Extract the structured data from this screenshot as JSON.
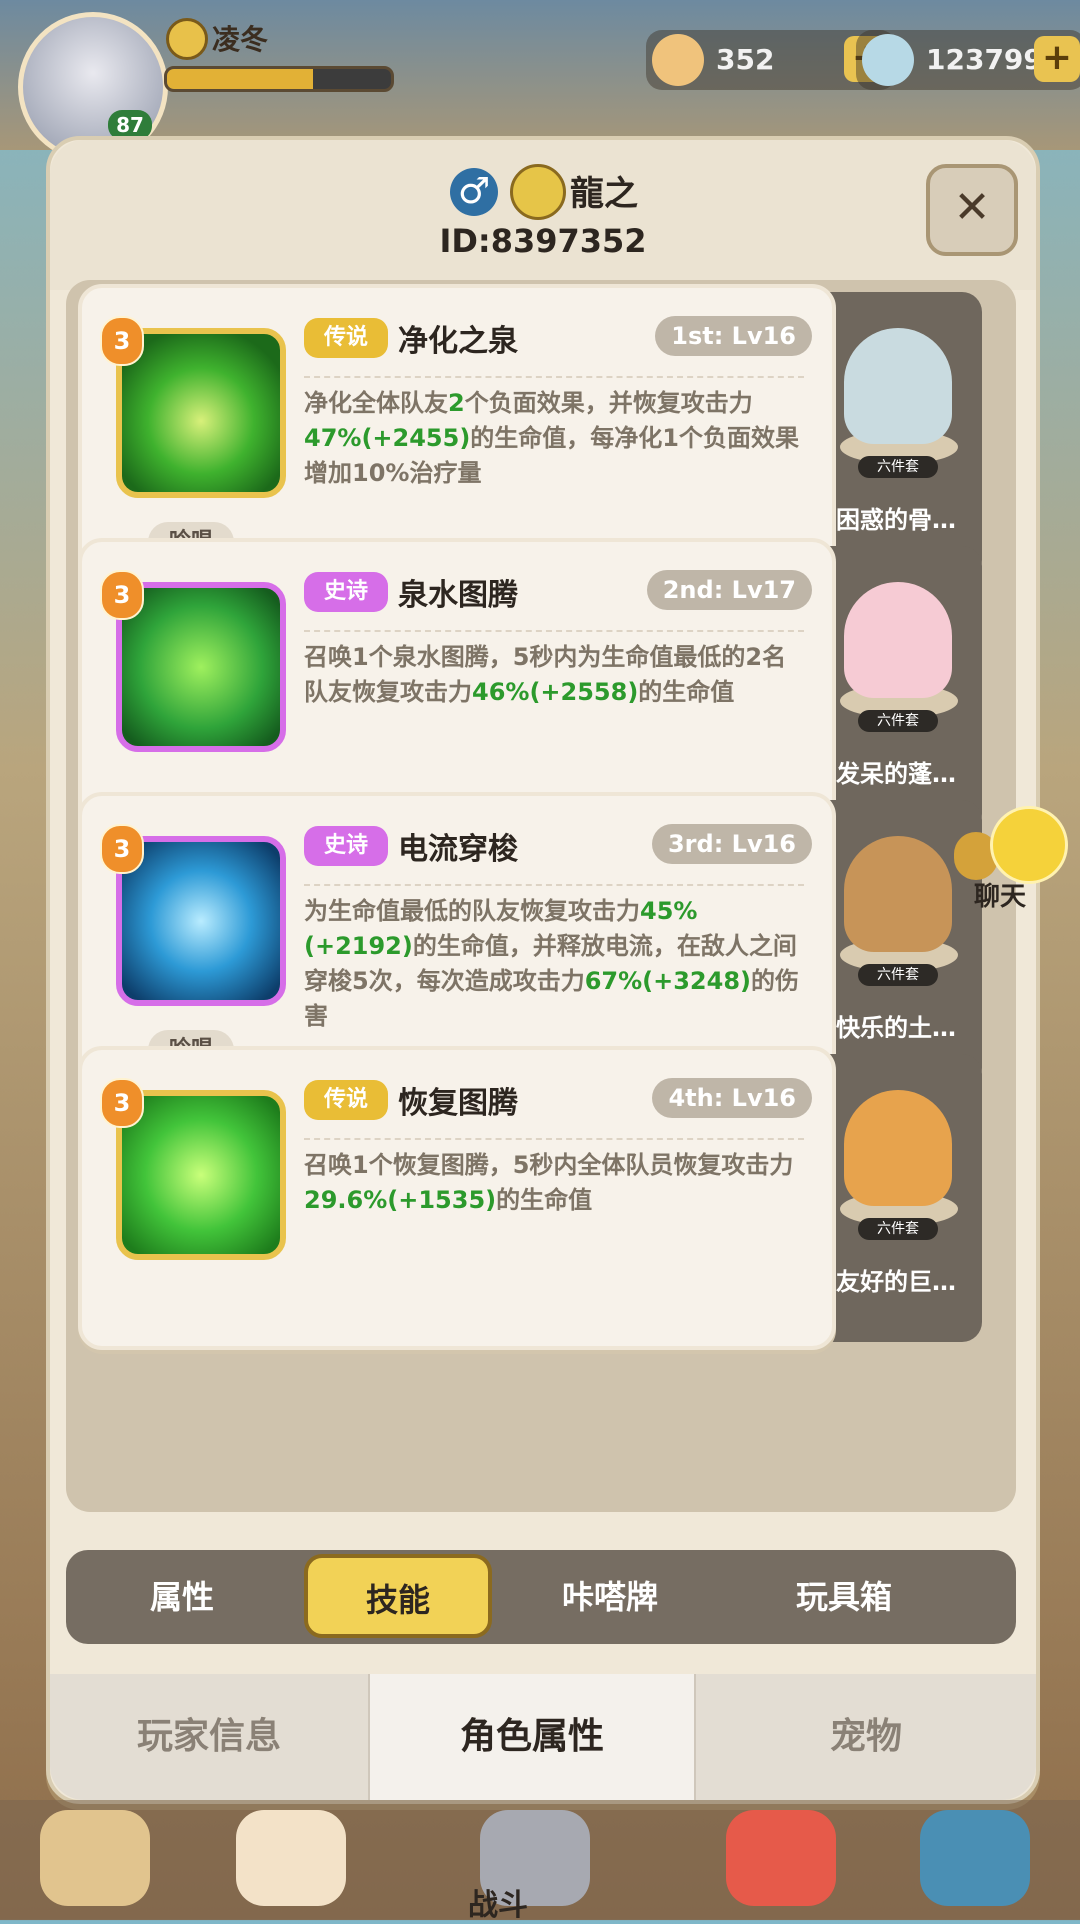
{
  "header": {
    "player_name": "凌冬",
    "avatar_level": "87",
    "xp_fraction": 0.65,
    "currency_1": "352",
    "currency_2": "123799"
  },
  "modal": {
    "title_name": "龍之",
    "id_text": "ID:8397352",
    "close_symbol": "✕"
  },
  "skills": [
    {
      "rarity": "传说",
      "name": "净化之泉",
      "rank": "1st: Lv16",
      "badge": "3",
      "chant": "吟唱",
      "desc_parts": [
        "净化全体队友",
        "2",
        "个负面效果，并恢复攻击力",
        "47%(+2455)",
        "的生命值，每净化1个负面效果增加10%治疗量"
      ],
      "rune_tag": "六件套",
      "rune_name": "困惑的骨…"
    },
    {
      "rarity": "史诗",
      "name": "泉水图腾",
      "rank": "2nd: Lv17",
      "badge": "3",
      "chant": "",
      "desc_parts": [
        "召唤1个泉水图腾，5秒内为生命值最低的2名队友恢复攻击力",
        "46%(+2558)",
        "的生命值"
      ],
      "rune_tag": "六件套",
      "rune_name": "发呆的蓬…"
    },
    {
      "rarity": "史诗",
      "name": "电流穿梭",
      "rank": "3rd: Lv16",
      "badge": "3",
      "chant": "吟唱",
      "desc_parts": [
        "为生命值最低的队友恢复攻击力",
        "45%(+2192)",
        "的生命值，并释放电流，在敌人之间穿梭5次，每次造成攻击力",
        "67%(+3248)",
        "的伤害"
      ],
      "rune_tag": "六件套",
      "rune_name": "快乐的土…"
    },
    {
      "rarity": "传说",
      "name": "恢复图腾",
      "rank": "4th: Lv16",
      "badge": "3",
      "chant": "",
      "desc_parts": [
        "召唤1个恢复图腾，5秒内全体队员恢复攻击力",
        "29.6%(+1535)",
        "的生命值"
      ],
      "rune_tag": "六件套",
      "rune_name": "友好的巨…"
    }
  ],
  "tabs": [
    "属性",
    "技能",
    "咔嗒牌",
    "玩具箱"
  ],
  "bottom_tabs": [
    "玩家信息",
    "角色属性",
    "宠物"
  ],
  "chat_label": "聊天",
  "nav_label": "战斗",
  "colors": {
    "legend": "#e9bd36",
    "epic": "#d66ee8",
    "highlight_green": "#2c9a2c",
    "active_tab": "#f2d256"
  }
}
